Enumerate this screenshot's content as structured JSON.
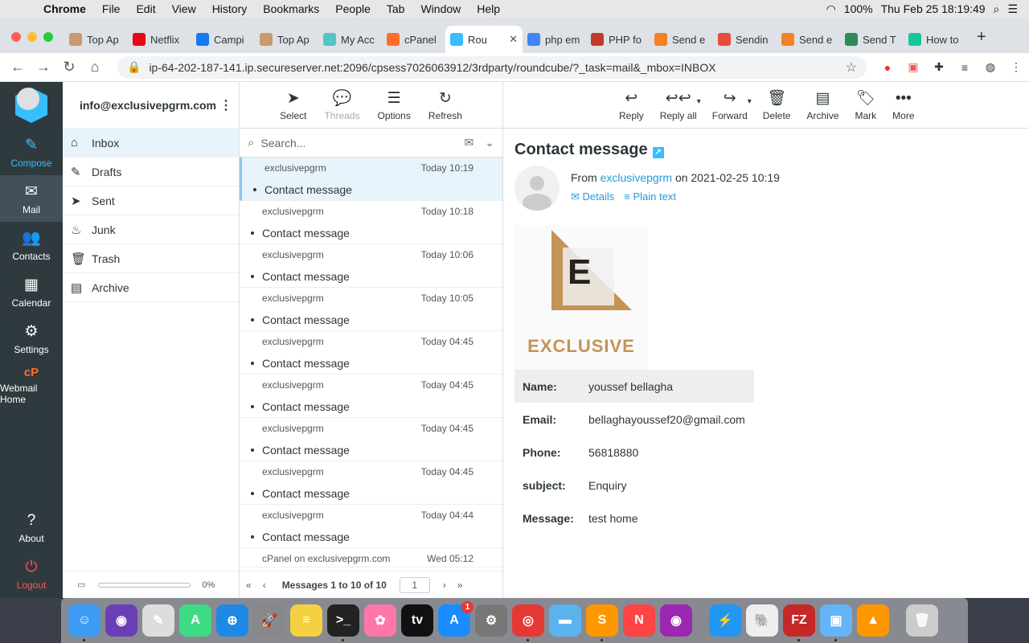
{
  "menubar": {
    "app": "Chrome",
    "items": [
      "File",
      "Edit",
      "View",
      "History",
      "Bookmarks",
      "People",
      "Tab",
      "Window",
      "Help"
    ],
    "battery": "100%",
    "clock": "Thu Feb 25  18:19:49"
  },
  "tabs": [
    {
      "label": "Top Ap",
      "color": "#c89a6c",
      "icon": "app-icon"
    },
    {
      "label": "Netflix",
      "color": "#e50914",
      "icon": "netflix-icon"
    },
    {
      "label": "Campi",
      "color": "#1877f2",
      "icon": "facebook-icon"
    },
    {
      "label": "Top Ap",
      "color": "#c89a6c",
      "icon": "app-icon"
    },
    {
      "label": "My Acc",
      "color": "#52c5c5",
      "icon": "account-icon"
    },
    {
      "label": "cPanel",
      "color": "#ff6c2c",
      "icon": "cpanel-icon"
    },
    {
      "label": "Rou",
      "color": "#37beff",
      "icon": "roundcube-icon",
      "active": true
    },
    {
      "label": "php em",
      "color": "#4285f4",
      "icon": "google-icon"
    },
    {
      "label": "PHP fo",
      "color": "#c0392b",
      "icon": "php-icon"
    },
    {
      "label": "Send e",
      "color": "#f48024",
      "icon": "stackoverflow-icon"
    },
    {
      "label": "Sendin",
      "color": "#e74c3c",
      "icon": "sendinblue-icon"
    },
    {
      "label": "Send e",
      "color": "#f48024",
      "icon": "stackoverflow-icon"
    },
    {
      "label": "Send T",
      "color": "#2e8b57",
      "icon": "cw-icon"
    },
    {
      "label": "How to",
      "color": "#16c79a",
      "icon": "howto-icon"
    }
  ],
  "url": "ip-64-202-187-141.ip.secureserver.net:2096/cpsess7026063912/3rdparty/roundcube/?_task=mail&_mbox=INBOX",
  "nav": [
    {
      "label": "Compose",
      "icon": "compose-icon",
      "glyph": "✎",
      "cls": "compose"
    },
    {
      "label": "Mail",
      "icon": "mail-icon",
      "glyph": "✉",
      "cls": "active"
    },
    {
      "label": "Contacts",
      "icon": "contacts-icon",
      "glyph": "👥",
      "cls": ""
    },
    {
      "label": "Calendar",
      "icon": "calendar-icon",
      "glyph": "▦",
      "cls": ""
    },
    {
      "label": "Settings",
      "icon": "gear-icon",
      "glyph": "⚙",
      "cls": ""
    },
    {
      "label": "Webmail Home",
      "icon": "cpanel-icon",
      "glyph": "cP",
      "cls": "cpanel"
    }
  ],
  "nav_bottom": [
    {
      "label": "About",
      "icon": "help-icon",
      "glyph": "?"
    },
    {
      "label": "Logout",
      "icon": "power-icon",
      "glyph": "⏻"
    }
  ],
  "account": "info@exclusivepgrm.com",
  "folders": [
    {
      "label": "Inbox",
      "icon": "inbox-icon",
      "glyph": "⌂",
      "sel": true
    },
    {
      "label": "Drafts",
      "icon": "pencil-icon",
      "glyph": "✎"
    },
    {
      "label": "Sent",
      "icon": "send-icon",
      "glyph": "➤"
    },
    {
      "label": "Junk",
      "icon": "fire-icon",
      "glyph": "♨"
    },
    {
      "label": "Trash",
      "icon": "trash-icon",
      "glyph": "🗑"
    },
    {
      "label": "Archive",
      "icon": "archive-icon",
      "glyph": "▤"
    }
  ],
  "quota": "0%",
  "list_toolbar": [
    {
      "label": "Select",
      "icon": "cursor-icon",
      "glyph": "➤"
    },
    {
      "label": "Threads",
      "icon": "threads-icon",
      "glyph": "💬",
      "disabled": true
    },
    {
      "label": "Options",
      "icon": "options-icon",
      "glyph": "☰"
    },
    {
      "label": "Refresh",
      "icon": "refresh-icon",
      "glyph": "↻"
    }
  ],
  "search_placeholder": "Search...",
  "messages": [
    {
      "from": "exclusivepgrm",
      "date": "Today 10:19",
      "subject": "Contact message",
      "sel": true
    },
    {
      "from": "exclusivepgrm",
      "date": "Today 10:18",
      "subject": "Contact message"
    },
    {
      "from": "exclusivepgrm",
      "date": "Today 10:06",
      "subject": "Contact message"
    },
    {
      "from": "exclusivepgrm",
      "date": "Today 10:05",
      "subject": "Contact message"
    },
    {
      "from": "exclusivepgrm",
      "date": "Today 04:45",
      "subject": "Contact message"
    },
    {
      "from": "exclusivepgrm",
      "date": "Today 04:45",
      "subject": "Contact message"
    },
    {
      "from": "exclusivepgrm",
      "date": "Today 04:45",
      "subject": "Contact message"
    },
    {
      "from": "exclusivepgrm",
      "date": "Today 04:45",
      "subject": "Contact message"
    },
    {
      "from": "exclusivepgrm",
      "date": "Today 04:44",
      "subject": "Contact message"
    },
    {
      "from": "cPanel on exclusivepgrm.com",
      "date": "Wed 05:12",
      "subject": ""
    }
  ],
  "pager": {
    "count": "Messages 1 to 10 of 10",
    "page": "1"
  },
  "view_toolbar": [
    {
      "label": "Reply",
      "icon": "reply-icon",
      "glyph": "↩"
    },
    {
      "label": "Reply all",
      "icon": "reply-all-icon",
      "glyph": "↩↩",
      "caret": true
    },
    {
      "label": "Forward",
      "icon": "forward-icon",
      "glyph": "↪",
      "caret": true
    },
    {
      "label": "Delete",
      "icon": "trash-icon",
      "glyph": "🗑"
    },
    {
      "label": "Archive",
      "icon": "archive-icon",
      "glyph": "▤"
    },
    {
      "label": "Mark",
      "icon": "tag-icon",
      "glyph": "🏷"
    },
    {
      "label": "More",
      "icon": "more-icon",
      "glyph": "•••"
    }
  ],
  "email": {
    "subject": "Contact message",
    "from_prefix": "From",
    "from_name": "exclusivepgrm",
    "date": "on 2021-02-25 10:19",
    "details": "Details",
    "plain": "Plain text",
    "logo_title": "EXCLUSIVE",
    "logo_letter": "E",
    "fields": [
      {
        "k": "Name:",
        "v": "youssef bellagha"
      },
      {
        "k": "Email:",
        "v": "bellaghayoussef20@gmail.com"
      },
      {
        "k": "Phone:",
        "v": "56818880"
      },
      {
        "k": "subject:",
        "v": "Enquiry"
      },
      {
        "k": "Message:",
        "v": "test home"
      }
    ]
  },
  "dock": [
    {
      "name": "finder",
      "color": "#3d9bf5",
      "glyph": "☺",
      "run": true
    },
    {
      "name": "siri",
      "color": "#6a3fb5",
      "glyph": "◉"
    },
    {
      "name": "textedit",
      "color": "#ddd",
      "glyph": "✎"
    },
    {
      "name": "android-studio",
      "color": "#3ddc84",
      "glyph": "A"
    },
    {
      "name": "safari",
      "color": "#1e88e5",
      "glyph": "⊕"
    },
    {
      "name": "launchpad",
      "color": "#888",
      "glyph": "🚀"
    },
    {
      "name": "notes",
      "color": "#f5d142",
      "glyph": "≡"
    },
    {
      "name": "terminal",
      "color": "#222",
      "glyph": ">_",
      "run": true
    },
    {
      "name": "photos",
      "color": "#f7a",
      "glyph": "✿"
    },
    {
      "name": "apple-tv",
      "color": "#111",
      "glyph": "tv"
    },
    {
      "name": "app-store",
      "color": "#1a8cff",
      "glyph": "A",
      "badge": "1"
    },
    {
      "name": "system-preferences",
      "color": "#777",
      "glyph": "⚙"
    },
    {
      "name": "chrome",
      "color": "#e53935",
      "glyph": "◎",
      "run": true
    },
    {
      "name": "folder",
      "color": "#5bb3ee",
      "glyph": "▬"
    },
    {
      "name": "sublime",
      "color": "#ff9800",
      "glyph": "S",
      "run": true
    },
    {
      "name": "news",
      "color": "#f44",
      "glyph": "N"
    },
    {
      "name": "podcasts",
      "color": "#9c27b0",
      "glyph": "◉"
    },
    {
      "sep": true
    },
    {
      "name": "messenger",
      "color": "#2196f3",
      "glyph": "⚡"
    },
    {
      "name": "sequel-pro",
      "color": "#eee",
      "glyph": "🐘"
    },
    {
      "name": "filezilla",
      "color": "#c62828",
      "glyph": "FZ",
      "run": true
    },
    {
      "name": "preview",
      "color": "#64b5f6",
      "glyph": "▣",
      "run": true
    },
    {
      "name": "vlc",
      "color": "#ff9800",
      "glyph": "▲"
    },
    {
      "sep": true
    },
    {
      "name": "trash",
      "color": "#ccc",
      "glyph": "🗑"
    }
  ]
}
